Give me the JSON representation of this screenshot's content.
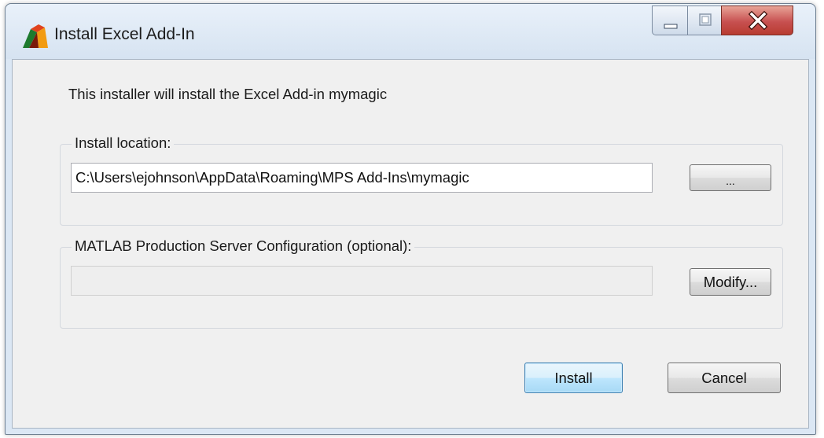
{
  "window": {
    "title": "Install Excel Add-In",
    "app_icon": "matlab-icon",
    "caption_buttons": [
      "minimize-icon",
      "maximize-icon",
      "close-icon"
    ],
    "colors": {
      "close_button": "#c75050",
      "default_button_border": "#3c7fb1"
    }
  },
  "intro_text": "This installer will install the Excel Add-in mymagic",
  "install_location": {
    "label": "Install location:",
    "path_value": "C:\\Users\\ejohnson\\AppData\\Roaming\\MPS Add-Ins\\mymagic",
    "browse_label": "..."
  },
  "server_config": {
    "label": "MATLAB Production Server Configuration (optional):",
    "value": "",
    "modify_label": "Modify..."
  },
  "actions": {
    "install_label": "Install",
    "cancel_label": "Cancel"
  }
}
